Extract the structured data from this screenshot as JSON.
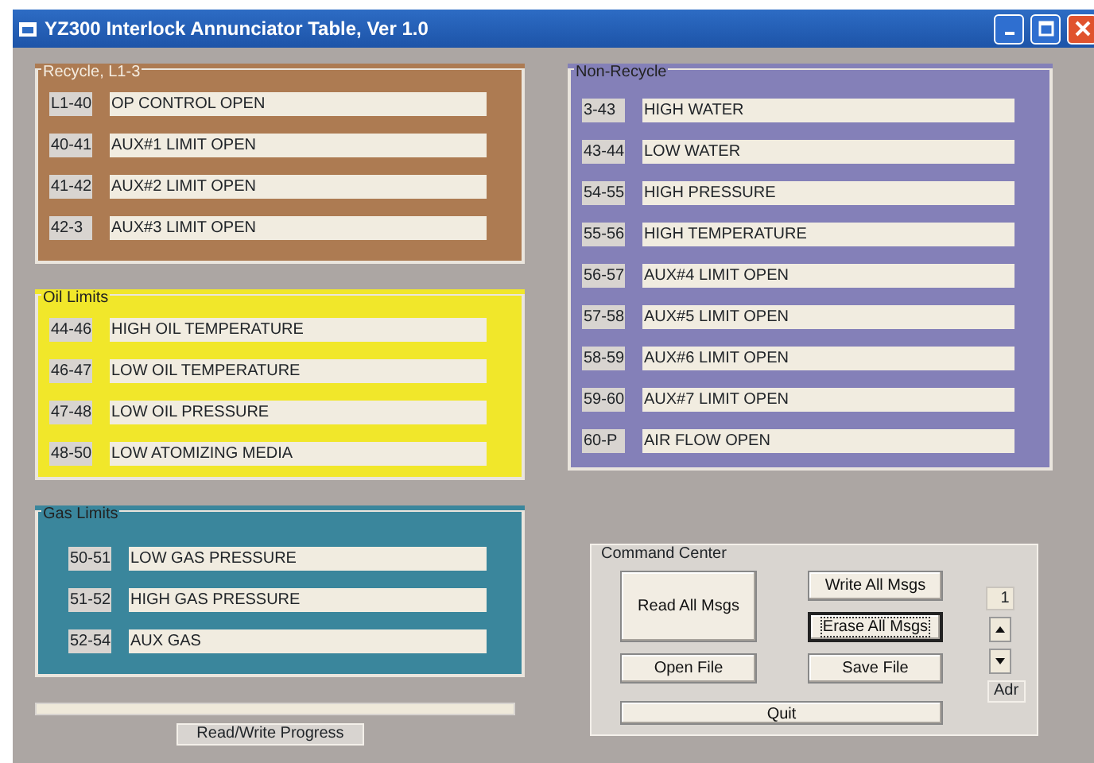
{
  "window": {
    "title": "YZ300 Interlock Annunciator Table, Ver 1.0"
  },
  "groups": [
    {
      "title": "Recycle, L1-3",
      "color": "#ad7b52",
      "light_title": true,
      "rows": [
        {
          "code": "L1-40",
          "message": "OP CONTROL OPEN"
        },
        {
          "code": "40-41",
          "message": "AUX#1 LIMIT OPEN"
        },
        {
          "code": "41-42",
          "message": "AUX#2 LIMIT OPEN"
        },
        {
          "code": "42-3",
          "message": "AUX#3 LIMIT OPEN"
        }
      ]
    },
    {
      "title": "Oil Limits",
      "color": "#f1e72a",
      "light_title": false,
      "rows": [
        {
          "code": "44-46",
          "message": "HIGH OIL TEMPERATURE"
        },
        {
          "code": "46-47",
          "message": "LOW OIL TEMPERATURE"
        },
        {
          "code": "47-48",
          "message": "LOW OIL PRESSURE"
        },
        {
          "code": "48-50",
          "message": "LOW ATOMIZING MEDIA"
        }
      ]
    },
    {
      "title": "Gas Limits",
      "color": "#3a869c",
      "light_title": false,
      "rows": [
        {
          "code": "50-51",
          "message": "LOW GAS PRESSURE"
        },
        {
          "code": "51-52",
          "message": "HIGH GAS PRESSURE"
        },
        {
          "code": "52-54",
          "message": "AUX GAS"
        }
      ]
    },
    {
      "title": "Non-Recycle",
      "color": "#8480b8",
      "light_title": false,
      "rows": [
        {
          "code": "3-43",
          "message": "HIGH WATER"
        },
        {
          "code": "43-44",
          "message": "LOW WATER"
        },
        {
          "code": "54-55",
          "message": "HIGH PRESSURE"
        },
        {
          "code": "55-56",
          "message": "HIGH TEMPERATURE"
        },
        {
          "code": "56-57",
          "message": "AUX#4 LIMIT OPEN"
        },
        {
          "code": "57-58",
          "message": "AUX#5 LIMIT OPEN"
        },
        {
          "code": "58-59",
          "message": "AUX#6 LIMIT OPEN"
        },
        {
          "code": "59-60",
          "message": "AUX#7 LIMIT OPEN"
        },
        {
          "code": "60-P",
          "message": "AIR FLOW OPEN"
        }
      ]
    }
  ],
  "progress": {
    "level": 0,
    "label": "Read/Write Progress"
  },
  "command_center": {
    "title": "Command Center",
    "buttons": [
      {
        "label": "Read All Msgs",
        "kind": "large",
        "focused": false
      },
      {
        "label": "Write All Msgs",
        "kind": "normal",
        "focused": false
      },
      {
        "label": "Erase All Msgs",
        "kind": "normal",
        "focused": true
      },
      {
        "label": "Open File",
        "kind": "normal",
        "focused": false
      },
      {
        "label": "Save File",
        "kind": "normal",
        "focused": false
      },
      {
        "label": "Quit",
        "kind": "wide",
        "focused": false
      }
    ],
    "address": {
      "value": "1",
      "label": "Adr"
    }
  }
}
